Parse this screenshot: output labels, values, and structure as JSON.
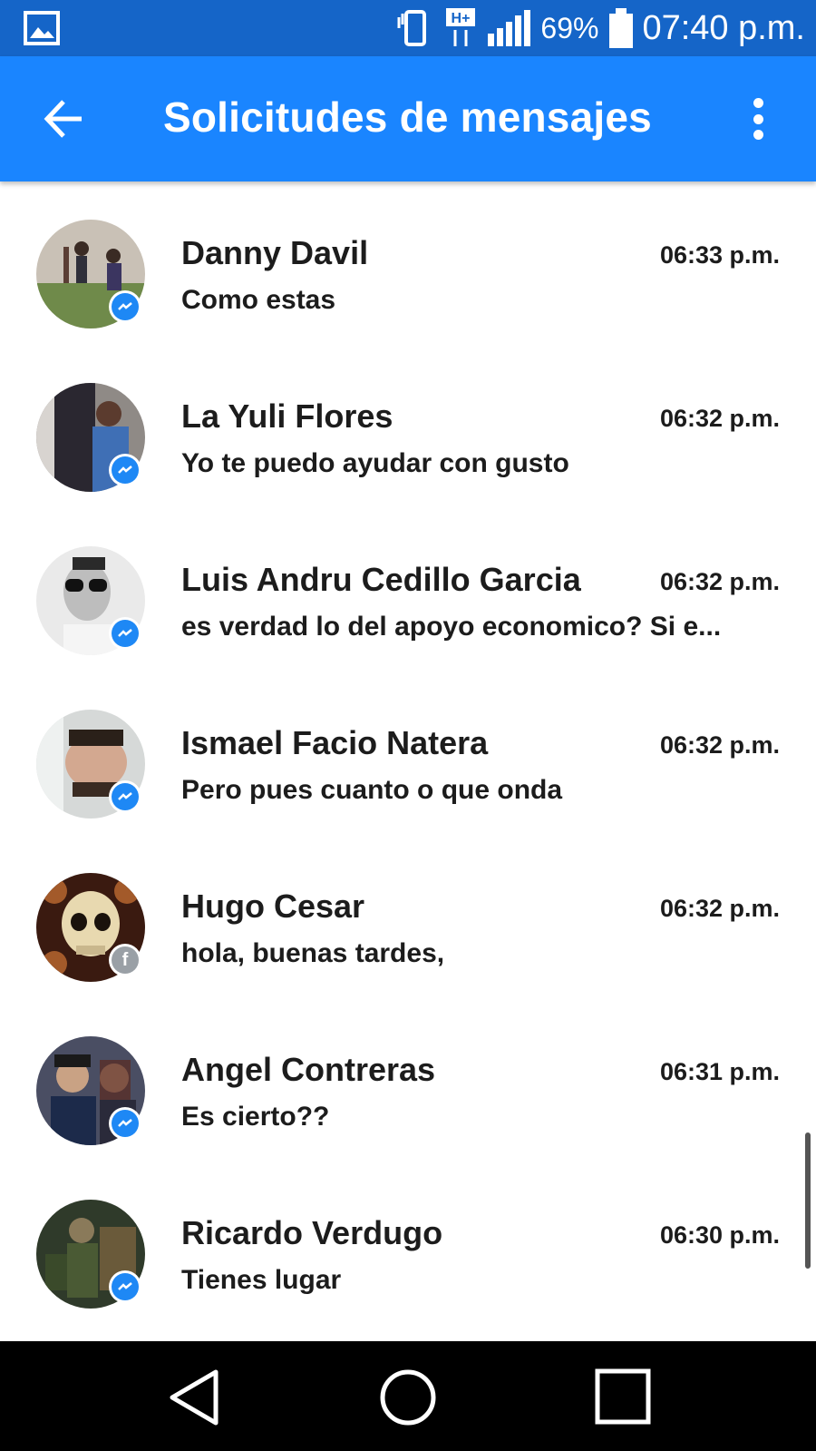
{
  "status_bar": {
    "battery_percent": "69%",
    "time": "07:40 p.m.",
    "network": "H+",
    "icons": [
      "gallery-icon",
      "vibrate-icon",
      "network-hplus-icon",
      "signal-icon",
      "battery-icon"
    ]
  },
  "app_bar": {
    "title": "Solicitudes de mensajes",
    "back_icon": "arrow-left-icon",
    "more_icon": "more-vert-icon"
  },
  "conversations": [
    {
      "name": "Danny Davil",
      "time": "06:33 p.m.",
      "message": "Como estas",
      "badge": "messenger"
    },
    {
      "name": "La Yuli Flores",
      "time": "06:32 p.m.",
      "message": "Yo te puedo ayudar con gusto",
      "badge": "messenger"
    },
    {
      "name": "Luis Andru Cedillo Garcia",
      "time": "06:32 p.m.",
      "message": "es verdad lo del apoyo economico? Si e...",
      "badge": "messenger"
    },
    {
      "name": "Ismael Facio Natera",
      "time": "06:32 p.m.",
      "message": "Pero pues cuanto o que onda",
      "badge": "messenger"
    },
    {
      "name": "Hugo Cesar",
      "time": "06:32 p.m.",
      "message": "hola, buenas tardes,",
      "badge": "facebook"
    },
    {
      "name": "Angel Contreras",
      "time": "06:31 p.m.",
      "message": "Es cierto??",
      "badge": "messenger"
    },
    {
      "name": "Ricardo Verdugo",
      "time": "06:30 p.m.",
      "message": "Tienes lugar",
      "badge": "messenger"
    }
  ],
  "nav_bar": {
    "icons": [
      "back-triangle-icon",
      "home-circle-icon",
      "recents-square-icon"
    ]
  },
  "colors": {
    "status_bar": "#1565c8",
    "app_bar": "#1a85ff",
    "messenger_badge": "#1e88f5",
    "facebook_badge": "#9aa0a6",
    "nav_bar": "#000000"
  }
}
